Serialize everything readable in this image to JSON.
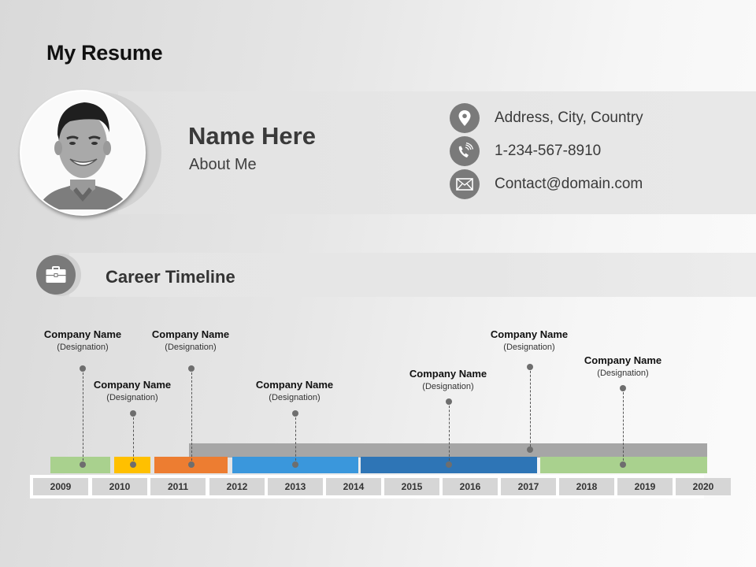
{
  "page": {
    "title": "My Resume"
  },
  "profile": {
    "photo_icon": "person-photo",
    "name": "Name Here",
    "about": "About Me"
  },
  "contacts": [
    {
      "icon": "map-pin-icon",
      "text": "Address, City, Country"
    },
    {
      "icon": "phone-icon",
      "text": "1-234-567-8910"
    },
    {
      "icon": "envelope-icon",
      "text": "Contact@domain.com"
    }
  ],
  "career": {
    "icon": "briefcase-icon",
    "title": "Career Timeline"
  },
  "timeline": {
    "years": [
      "2009",
      "2010",
      "2011",
      "2012",
      "2013",
      "2014",
      "2015",
      "2016",
      "2017",
      "2018",
      "2019",
      "2020"
    ],
    "colors": {
      "green": "#a9d18e",
      "yellow": "#ffc000",
      "orange": "#ed7d31",
      "light_blue": "#3a97dc",
      "dark_blue": "#2e75b6",
      "gray": "#a6a6a6"
    },
    "entries": [
      {
        "company": "Company Name",
        "designation": "(Designation)"
      },
      {
        "company": "Company Name",
        "designation": "(Designation)"
      },
      {
        "company": "Company Name",
        "designation": "(Designation)"
      },
      {
        "company": "Company Name",
        "designation": "(Designation)"
      },
      {
        "company": "Company Name",
        "designation": "(Designation)"
      },
      {
        "company": "Company Name",
        "designation": "(Designation)"
      },
      {
        "company": "Company Name",
        "designation": "(Designation)"
      }
    ]
  }
}
